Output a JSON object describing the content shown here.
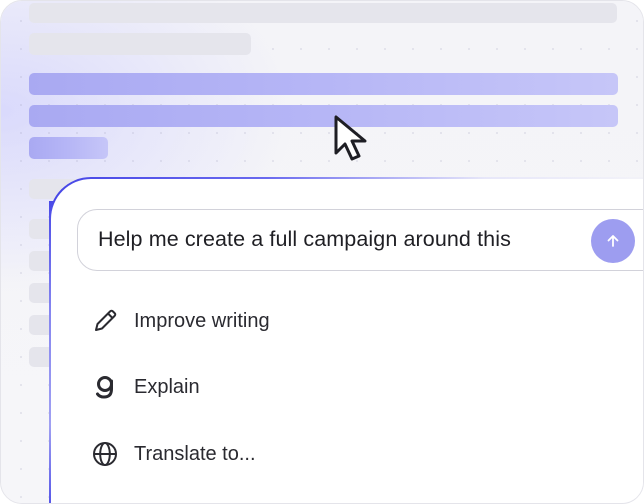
{
  "prompt": {
    "text": "Help me create a full campaign around this",
    "send_icon": "arrow-up-icon"
  },
  "menu": {
    "items": [
      {
        "label": "Improve writing",
        "icon": "pencil-icon"
      },
      {
        "label": "Explain",
        "icon": "grammarly-g-icon"
      },
      {
        "label": "Translate to...",
        "icon": "globe-icon"
      }
    ]
  },
  "colors": {
    "accent": "#4646e6",
    "highlight": "#b3b3f5",
    "send_button": "#9d9df0"
  }
}
